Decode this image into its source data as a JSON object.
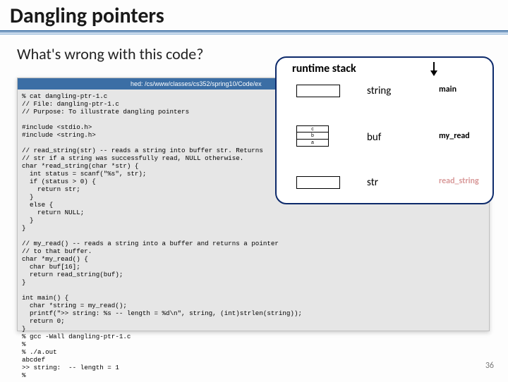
{
  "title": "Dangling pointers",
  "subtitle": "What's wrong with this code?",
  "terminal_title": "hed: /cs/www/classes/cs352/spring10/Code/ex",
  "code": "% cat dangling-ptr-1.c\n// File: dangling-ptr-1.c\n// Purpose: To illustrate dangling pointers\n\n#include <stdio.h>\n#include <string.h>\n\n// read_string(str) -- reads a string into buffer str. Returns\n// str if a string was successfully read, NULL otherwise.\nchar *read_string(char *str) {\n  int status = scanf(\"%s\", str);\n  if (status > 0) {\n    return str;\n  }\n  else {\n    return NULL;\n  }\n}\n\n// my_read() -- reads a string into a buffer and returns a pointer\n// to that buffer.\nchar *my_read() {\n  char buf[16];\n  return read_string(buf);\n}\n\nint main() {\n  char *string = my_read();\n  printf(\">> string: %s -- length = %d\\n\", string, (int)strlen(string));\n  return 0;\n}\n% gcc -Wall dangling-ptr-1.c\n%\n% ./a.out\nabcdef\n>> string:  -- length = 1\n% ",
  "overlay": {
    "title": "runtime stack",
    "rows": {
      "main": {
        "label": "string",
        "frame": "main"
      },
      "myread": {
        "label": "buf",
        "frame": "my_read",
        "cells": [
          "c",
          "b",
          "a"
        ]
      },
      "readstring": {
        "label": "str",
        "frame": "read_string"
      }
    }
  },
  "page_number": "36"
}
